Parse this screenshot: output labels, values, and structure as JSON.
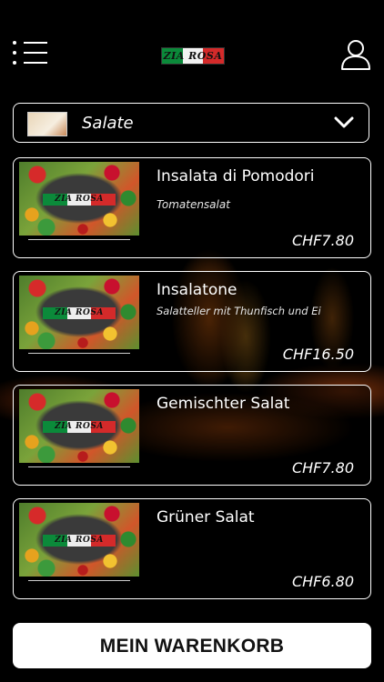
{
  "header": {
    "logo_text": "ZIA ROSA",
    "menu_icon": "hamburger-menu-icon",
    "user_icon": "user-profile-icon"
  },
  "category": {
    "selected": "Salate",
    "dropdown_icon": "chevron-down-icon"
  },
  "items": [
    {
      "name": "Insalata di Pomodori",
      "description": "Tomatensalat",
      "price": "CHF7.80",
      "image_logo": "ZIA ROSA"
    },
    {
      "name": "Insalatone",
      "description": "Salatteller mit Thunfisch und Ei",
      "price": "CHF16.50",
      "image_logo": "ZIA ROSA"
    },
    {
      "name": "Gemischter Salat",
      "description": "",
      "price": "CHF7.80",
      "image_logo": "ZIA ROSA"
    },
    {
      "name": "Grüner Salat",
      "description": "",
      "price": "CHF6.80",
      "image_logo": "ZIA ROSA"
    }
  ],
  "cart": {
    "label": "MEIN WARENKORB"
  },
  "colors": {
    "background": "#000000",
    "border": "#ffffff",
    "button_bg": "#ffffff",
    "button_text": "#111111"
  }
}
